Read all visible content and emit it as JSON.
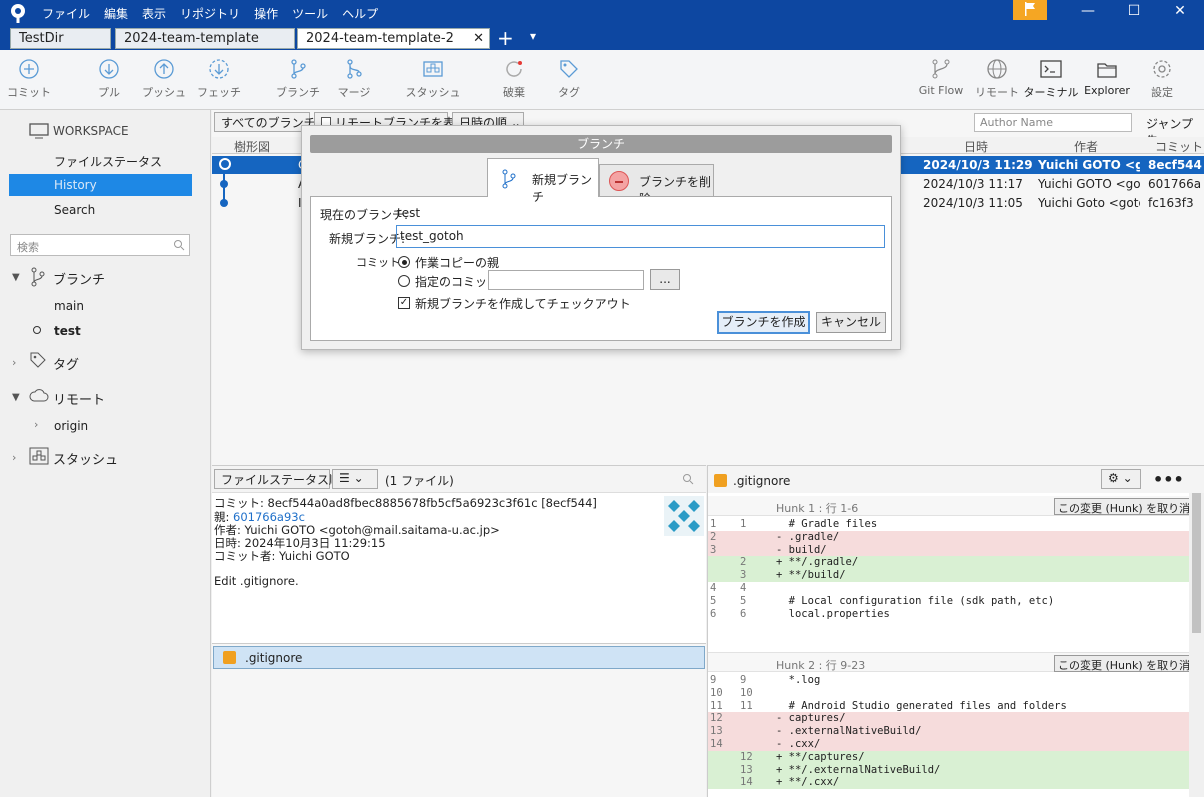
{
  "titlebar": {
    "menus": [
      "ファイル",
      "編集",
      "表示",
      "リポジトリ",
      "操作",
      "ツール",
      "ヘルプ"
    ],
    "minimize": "—",
    "maximize": "☐",
    "close": "✕"
  },
  "tabs": [
    {
      "label": "TestDir",
      "active": false
    },
    {
      "label": "2024-team-template",
      "active": false
    },
    {
      "label": "2024-team-template-2",
      "active": true
    }
  ],
  "tab_close": "✕",
  "tab_add": "+",
  "tab_menu": "▾",
  "toolbar": {
    "commit": "コミット",
    "pull": "プル",
    "push": "プッシュ",
    "fetch": "フェッチ",
    "branch": "ブランチ",
    "merge": "マージ",
    "stash": "スタッシュ",
    "discard": "破棄",
    "tag": "タグ",
    "gitflow": "Git Flow",
    "remote": "リモート",
    "terminal": "ターミナル",
    "explorer": "Explorer",
    "settings": "設定"
  },
  "sidebar": {
    "workspace": "WORKSPACE",
    "file_status": "ファイルステータス",
    "history": "History",
    "search": "Search",
    "search_placeholder": "検索",
    "branches": "ブランチ",
    "branch_items": [
      "main",
      "test"
    ],
    "tags": "タグ",
    "remotes": "リモート",
    "remote_items": [
      "origin"
    ],
    "stashes": "スタッシュ"
  },
  "history": {
    "branch_filter": "すべてのブランチ",
    "show_remote": "リモートブランチを表示",
    "sort": "日時の順",
    "author_placeholder": "Author Name",
    "jump_to": "ジャンプ先:",
    "columns": {
      "graph": "樹形図",
      "date": "日時",
      "author": "作者",
      "commit": "コミット"
    },
    "rows": [
      {
        "desc": "C",
        "date": "2024/10/3  11:29",
        "author": "Yuichi GOTO <goto",
        "commit": "8ecf544"
      },
      {
        "desc": "A",
        "date": "2024/10/3  11:17",
        "author": "Yuichi GOTO <goto",
        "commit": "601766a"
      },
      {
        "desc": "I",
        "date": "2024/10/3  11:05",
        "author": "Yuichi Goto <goto",
        "commit": "fc163f3"
      }
    ]
  },
  "details": {
    "file_sort": "ファイルステータス順",
    "file_count": "(1 ファイル)",
    "commit_line": "コミット: 8ecf544a0ad8fbec8885678fb5cf5a6923c3f61c [8ecf544]",
    "parent_label": "親: ",
    "parent_hash": "601766a93c",
    "author_line": "作者: Yuichi GOTO <gotoh@mail.saitama-u.ac.jp>",
    "date_line": "日時: 2024年10月3日 11:29:15",
    "committer_line": "コミット者: Yuichi GOTO",
    "message": "Edit .gitignore.",
    "file": ".gitignore"
  },
  "diff": {
    "file": ".gitignore",
    "hunk1": {
      "title": "Hunk 1 : 行 1-6",
      "discard": "この変更 (Hunk) を取り消す",
      "lines": [
        {
          "a": "1",
          "b": "1",
          "t": " ",
          "text": "# Gradle files"
        },
        {
          "a": "2",
          "b": "",
          "t": "-",
          "text": ".gradle/"
        },
        {
          "a": "3",
          "b": "",
          "t": "-",
          "text": "build/"
        },
        {
          "a": "",
          "b": "2",
          "t": "+",
          "text": "**/.gradle/"
        },
        {
          "a": "",
          "b": "3",
          "t": "+",
          "text": "**/build/"
        },
        {
          "a": "4",
          "b": "4",
          "t": " ",
          "text": ""
        },
        {
          "a": "5",
          "b": "5",
          "t": " ",
          "text": "# Local configuration file (sdk path, etc)"
        },
        {
          "a": "6",
          "b": "6",
          "t": " ",
          "text": "local.properties"
        }
      ]
    },
    "hunk2": {
      "title": "Hunk 2 : 行 9-23",
      "discard": "この変更 (Hunk) を取り消す",
      "lines": [
        {
          "a": "9",
          "b": "9",
          "t": " ",
          "text": "*.log"
        },
        {
          "a": "10",
          "b": "10",
          "t": " ",
          "text": ""
        },
        {
          "a": "11",
          "b": "11",
          "t": " ",
          "text": "# Android Studio generated files and folders"
        },
        {
          "a": "12",
          "b": "",
          "t": "-",
          "text": "captures/"
        },
        {
          "a": "13",
          "b": "",
          "t": "-",
          "text": ".externalNativeBuild/"
        },
        {
          "a": "14",
          "b": "",
          "t": "-",
          "text": ".cxx/"
        },
        {
          "a": "",
          "b": "12",
          "t": "+",
          "text": "**/captures/"
        },
        {
          "a": "",
          "b": "13",
          "t": "+",
          "text": "**/.externalNativeBuild/"
        },
        {
          "a": "",
          "b": "14",
          "t": "+",
          "text": "**/.cxx/"
        }
      ]
    }
  },
  "dialog": {
    "title": "ブランチ",
    "tab_new": "新規ブランチ",
    "tab_delete": "ブランチを削除",
    "current_branch_label": "現在のブランチ:",
    "current_branch": "test",
    "new_branch_label": "新規ブランチ:",
    "new_branch_value": "test_gotoh",
    "commit_label": "コミット:",
    "opt_working_parent": "作業コピーの親",
    "opt_specified": "指定のコミット:",
    "browse": "...",
    "checkout_label": "新規ブランチを作成してチェックアウト",
    "create": "ブランチを作成",
    "cancel": "キャンセル"
  },
  "colors": {
    "titlebar": "#0d47a1",
    "selection": "#1565c0",
    "accent": "#1e88e5",
    "flag": "#f5a623"
  }
}
